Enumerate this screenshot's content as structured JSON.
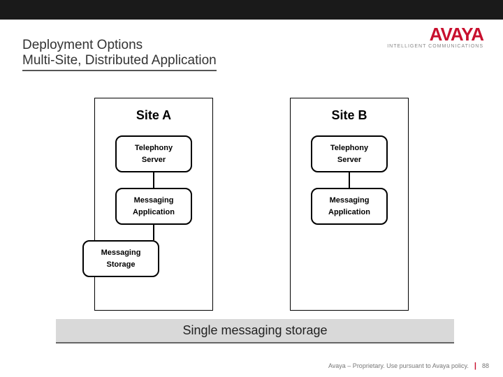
{
  "branding": {
    "logo": "AVAYA",
    "tagline": "INTELLIGENT COMMUNICATIONS"
  },
  "title": {
    "line1": "Deployment Options",
    "line2": "Multi-Site, Distributed Application"
  },
  "sites": {
    "a": {
      "title": "Site A",
      "telephony_line1": "Telephony",
      "telephony_line2": "Server",
      "messaging_line1": "Messaging",
      "messaging_line2": "Application",
      "storage_line1": "Messaging",
      "storage_line2": "Storage"
    },
    "b": {
      "title": "Site B",
      "telephony_line1": "Telephony",
      "telephony_line2": "Server",
      "messaging_line1": "Messaging",
      "messaging_line2": "Application"
    }
  },
  "caption": "Single messaging storage",
  "footer": {
    "text": "Avaya – Proprietary. Use pursuant to Avaya policy.",
    "page": "88"
  }
}
